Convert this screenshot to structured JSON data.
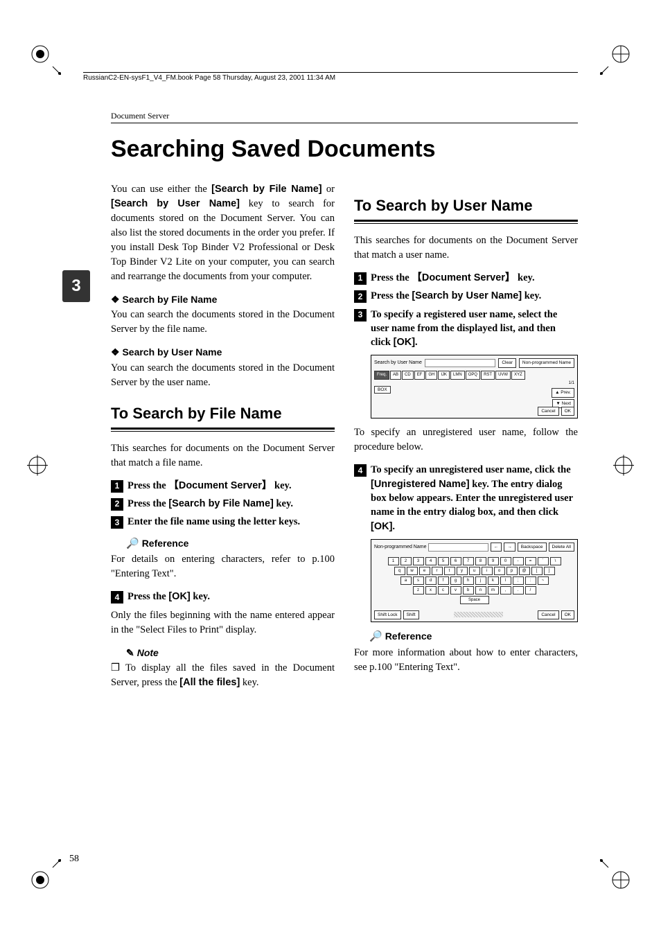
{
  "header_line": "RussianC2-EN-sysF1_V4_FM.book  Page 58  Thursday, August 23, 2001  11:34 AM",
  "running_head": "Document Server",
  "doc_title": "Searching Saved Documents",
  "side_tab": "3",
  "page_number": "58",
  "left": {
    "intro_a": "You can use either the ",
    "intro_key1": "[Search by File Name]",
    "intro_b": " or ",
    "intro_key2": "[Search by User Name]",
    "intro_c": " key to search for documents stored on the Document Server. You can also list the stored documents in the order you prefer. If you install Desk Top Binder V2 Professional or Desk Top Binder V2 Lite on your computer, you can search and rearrange the documents from your computer.",
    "sec1_title": "Search by File Name",
    "sec1_body": "You can search the documents stored in the Document Server by the file name.",
    "sec2_title": "Search by User Name",
    "sec2_body": "You can search the documents stored in the Document Server by the user name.",
    "h2": "To Search by File Name",
    "h2_intro": "This searches for documents on the Document Server that match a file name.",
    "step1_a": "Press the ",
    "step1_key": "【Document Server】",
    "step1_b": " key.",
    "step2_a": "Press the ",
    "step2_key": "[Search by File Name]",
    "step2_b": " key.",
    "step3": "Enter the file name using the letter keys.",
    "reference_label": "Reference",
    "reference_body": "For details on entering characters, refer to p.100 \"Entering Text\".",
    "step4_a": "Press the ",
    "step4_key": "[OK]",
    "step4_b": " key.",
    "step4_after": "Only the files beginning with the name entered appear in the \"Select Files to Print\" display.",
    "note_label": "Note",
    "note_body_a": "To display all the files saved in the Document Server, press the ",
    "note_key": "[All the files]",
    "note_body_b": " key."
  },
  "right": {
    "h2": "To Search by User Name",
    "h2_intro": "This searches for documents on the Document Server that match a user name.",
    "step1_a": "Press the ",
    "step1_key": "【Document Server】",
    "step1_b": " key.",
    "step2_a": "Press the ",
    "step2_key": "[Search by User Name]",
    "step2_b": " key.",
    "step3_a": "To specify a registered user name, select the user name from the displayed list, and then click ",
    "step3_key": "[OK]",
    "step3_b": ".",
    "ss1": {
      "label": "Search by User Name",
      "clear": "Clear",
      "nonprog": "Non-programmed Name",
      "tabs": [
        "Freq.",
        "AB",
        "CD",
        "EF",
        "GH",
        "IJK",
        "LMN",
        "OPQ",
        "RST",
        "UVW",
        "XYZ"
      ],
      "item": "BOX",
      "page": "1/1",
      "prev": "▲ Prev.",
      "next": "▼ Next",
      "cancel": "Cancel",
      "ok": "OK"
    },
    "after_ss1": "To specify an unregistered user name, follow the procedure below.",
    "step4_a": "To specify an unregistered user name, click the ",
    "step4_key": "[Unregistered Name]",
    "step4_b": " key. The entry dialog box below appears. Enter the unregistered user name in the entry dialog box, and then click ",
    "step4_key2": "[OK]",
    "step4_c": ".",
    "ss2": {
      "label": "Non-programmed Name",
      "back": "←",
      "fwd": "→",
      "backspace": "Backspace",
      "delall": "Delete All",
      "row1": [
        "1",
        "2",
        "3",
        "4",
        "5",
        "6",
        "7",
        "8",
        "9",
        "0",
        "-",
        "=",
        "`",
        "\\"
      ],
      "row2": [
        "q",
        "w",
        "e",
        "r",
        "t",
        "y",
        "u",
        "i",
        "o",
        "p",
        "@",
        "[",
        "]"
      ],
      "row3": [
        "a",
        "s",
        "d",
        "f",
        "g",
        "h",
        "j",
        "k",
        "l",
        ";",
        ":",
        "~"
      ],
      "row4": [
        "z",
        "x",
        "c",
        "v",
        "b",
        "n",
        "m",
        ",",
        ".",
        "/"
      ],
      "space": "Space",
      "shiftlock": "Shift Lock",
      "shift": "Shift",
      "cancel": "Cancel",
      "ok": "OK"
    },
    "reference_label": "Reference",
    "reference_body": "For more information about how to enter characters, see p.100 \"Entering Text\"."
  }
}
